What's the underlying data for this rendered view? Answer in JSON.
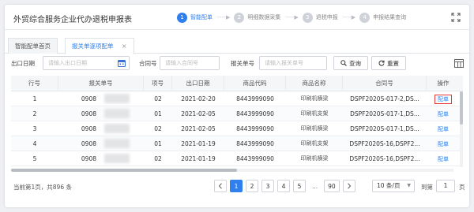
{
  "header": {
    "title": "外贸综合服务企业代办退税申报表",
    "steps": [
      {
        "num": "1",
        "label": "智能配单"
      },
      {
        "num": "2",
        "label": "明细数据采集"
      },
      {
        "num": "3",
        "label": "退税申报"
      },
      {
        "num": "4",
        "label": "申报结果查询"
      }
    ],
    "arrow": "- - - - ▶"
  },
  "tabs": [
    {
      "label": "智能配单首页"
    },
    {
      "label": "报关单逐项配单",
      "close": "×"
    }
  ],
  "search": {
    "export_date_label": "出口日期",
    "export_date_placeholder": "请输入出口日期",
    "contract_label": "合同号",
    "contract_placeholder": "请输入合同号",
    "customs_label": "报关单号",
    "customs_placeholder": "请输入报关单号",
    "query_label": "查询",
    "reset_label": "重置"
  },
  "table": {
    "columns": [
      "行号",
      "报关单号",
      "项号",
      "出口日期",
      "商品代码",
      "商品名称",
      "合同号",
      "操作"
    ],
    "rows": [
      {
        "row": "1",
        "customs_no": "0908",
        "item": "02",
        "date": "2021-02-20",
        "code": "8443999090",
        "name": "印刷机横梁",
        "contract": "DSPF2020S-017-2,DS...",
        "action": "配单"
      },
      {
        "row": "2",
        "customs_no": "0908",
        "item": "01",
        "date": "2021-02-05",
        "code": "8443999090",
        "name": "印刷机支架",
        "contract": "DSPF2020S-017-1,DS...",
        "action": "配单"
      },
      {
        "row": "3",
        "customs_no": "0908",
        "item": "02",
        "date": "2021-02-05",
        "code": "8443999090",
        "name": "印刷机横梁",
        "contract": "DSPF2020S-017-1,DS...",
        "action": "配单"
      },
      {
        "row": "4",
        "customs_no": "0908",
        "item": "01",
        "date": "2021-01-19",
        "code": "8443999090",
        "name": "印刷机支架",
        "contract": "DSPF2020S-16,DSPF2...",
        "action": "配单"
      },
      {
        "row": "5",
        "customs_no": "0908",
        "item": "02",
        "date": "2021-01-19",
        "code": "8443999090",
        "name": "印刷机横梁",
        "contract": "DSPF2020S-16,DSPF2...",
        "action": "配单"
      }
    ]
  },
  "footer": {
    "total_text": "当前第1页，共896 条",
    "pages": [
      "1",
      "2",
      "3",
      "4",
      "5"
    ],
    "ellipsis": "...",
    "last_page": "90",
    "page_size": "10 条/页",
    "goto_label": "到第",
    "goto_value": "1",
    "page_suffix": "页"
  },
  "colors": {
    "accent": "#2f80ed",
    "highlight": "#e53935"
  }
}
